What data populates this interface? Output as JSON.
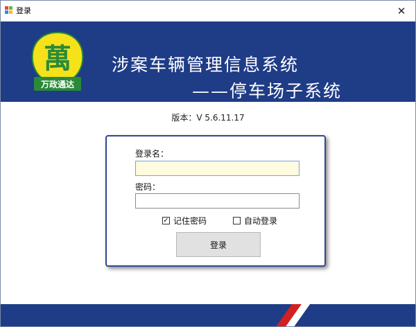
{
  "window": {
    "title": "登录",
    "close_glyph": "✕"
  },
  "banner": {
    "title_line1": "涉案车辆管理信息系统",
    "title_line2": "——停车场子系统",
    "logo_char": "萬",
    "logo_text": "万政通达"
  },
  "version": "版本：V 5.6.11.17",
  "login": {
    "username_label": "登录名：",
    "username_value": "",
    "password_label": "密码：",
    "password_value": "",
    "remember_label": "记住密码",
    "remember_checked": true,
    "auto_login_label": "自动登录",
    "auto_login_checked": false,
    "submit_label": "登录"
  },
  "colors": {
    "banner_blue": "#1f3c86",
    "accent_red": "#d32020",
    "panel_border": "#2d4a8e",
    "logo_yellow": "#f5e21b",
    "logo_green": "#2a8a3a"
  },
  "icons": {
    "app": "windows-app-icon",
    "close": "close-icon",
    "checkbox_checked": "checkbox-checked-icon",
    "checkbox_unchecked": "checkbox-unchecked-icon"
  }
}
